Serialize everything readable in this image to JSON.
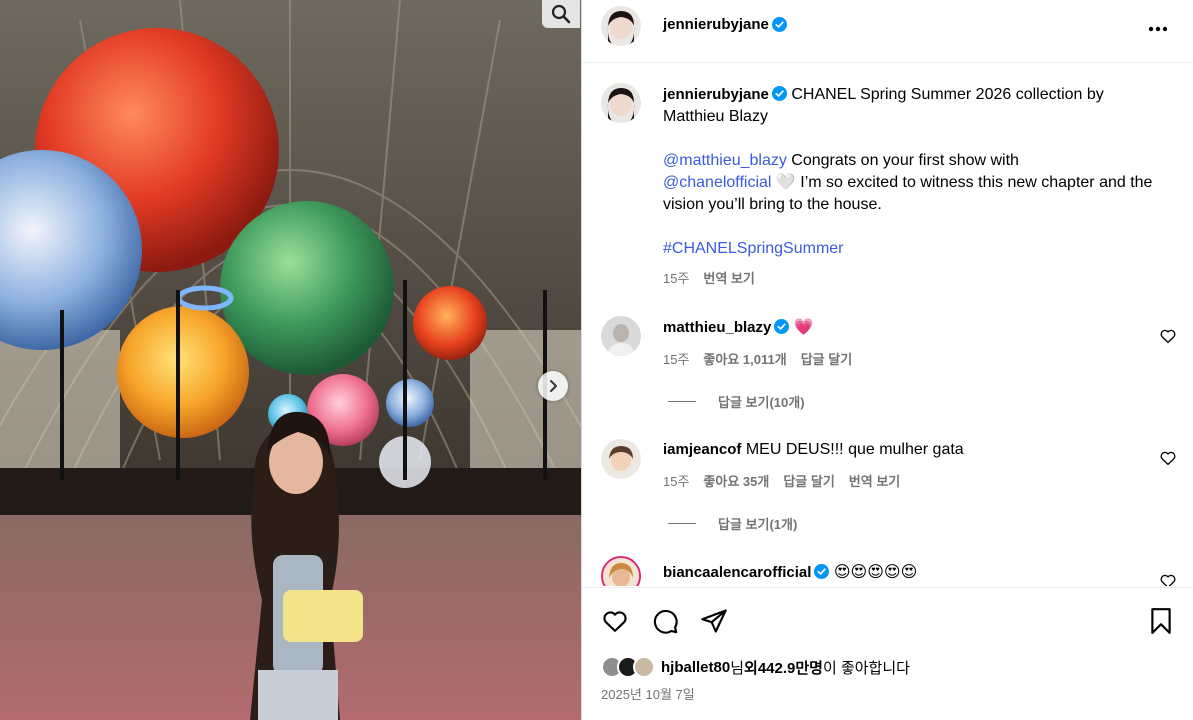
{
  "post": {
    "author": "jennierubyjane",
    "verified": true
  },
  "caption": {
    "author": "jennierubyjane",
    "line1": "CHANEL Spring Summer 2026 collection by Matthieu Blazy",
    "mention1": "@matthieu_blazy",
    "text2": " Congrats on your first show with",
    "mention2": "@chanelofficial",
    "heart": "🤍",
    "text3": " I’m so excited to witness this new chapter and the vision you’ll bring to the house.",
    "hashtag": "#CHANELSpringSummer",
    "time": "15주",
    "translate": "번역 보기"
  },
  "comments": [
    {
      "author": "matthieu_blazy",
      "verified": true,
      "text": "💗",
      "time": "15주",
      "likes": "좋아요 1,011개",
      "reply": "답글 달기",
      "view_replies": "답글 보기(10개)"
    },
    {
      "author": "iamjeancof",
      "verified": false,
      "text": "MEU DEUS!!! que mulher gata",
      "time": "15주",
      "likes": "좋아요 35개",
      "reply": "답글 달기",
      "translate": "번역 보기",
      "view_replies": "답글 보기(1개)"
    },
    {
      "author": "biancaalencarofficial",
      "verified": true,
      "text": "😍😍😍😍😍"
    }
  ],
  "likes": {
    "first_user": "hjballet80",
    "mid": "님 ",
    "others_prefix": "외 ",
    "count": "442.9만명",
    "suffix": "이 좋아합니다"
  },
  "date": "2025년 10월 7일",
  "icons": {
    "zoom": "magnifier-icon",
    "next": "chevron-right-icon",
    "more": "more-horizontal-icon",
    "like": "heart-icon",
    "comment": "comment-icon",
    "share": "share-icon",
    "save": "bookmark-icon"
  },
  "colors": {
    "link": "#3b5bdb",
    "verified": "#0095f6",
    "secondary_text": "#737373"
  }
}
